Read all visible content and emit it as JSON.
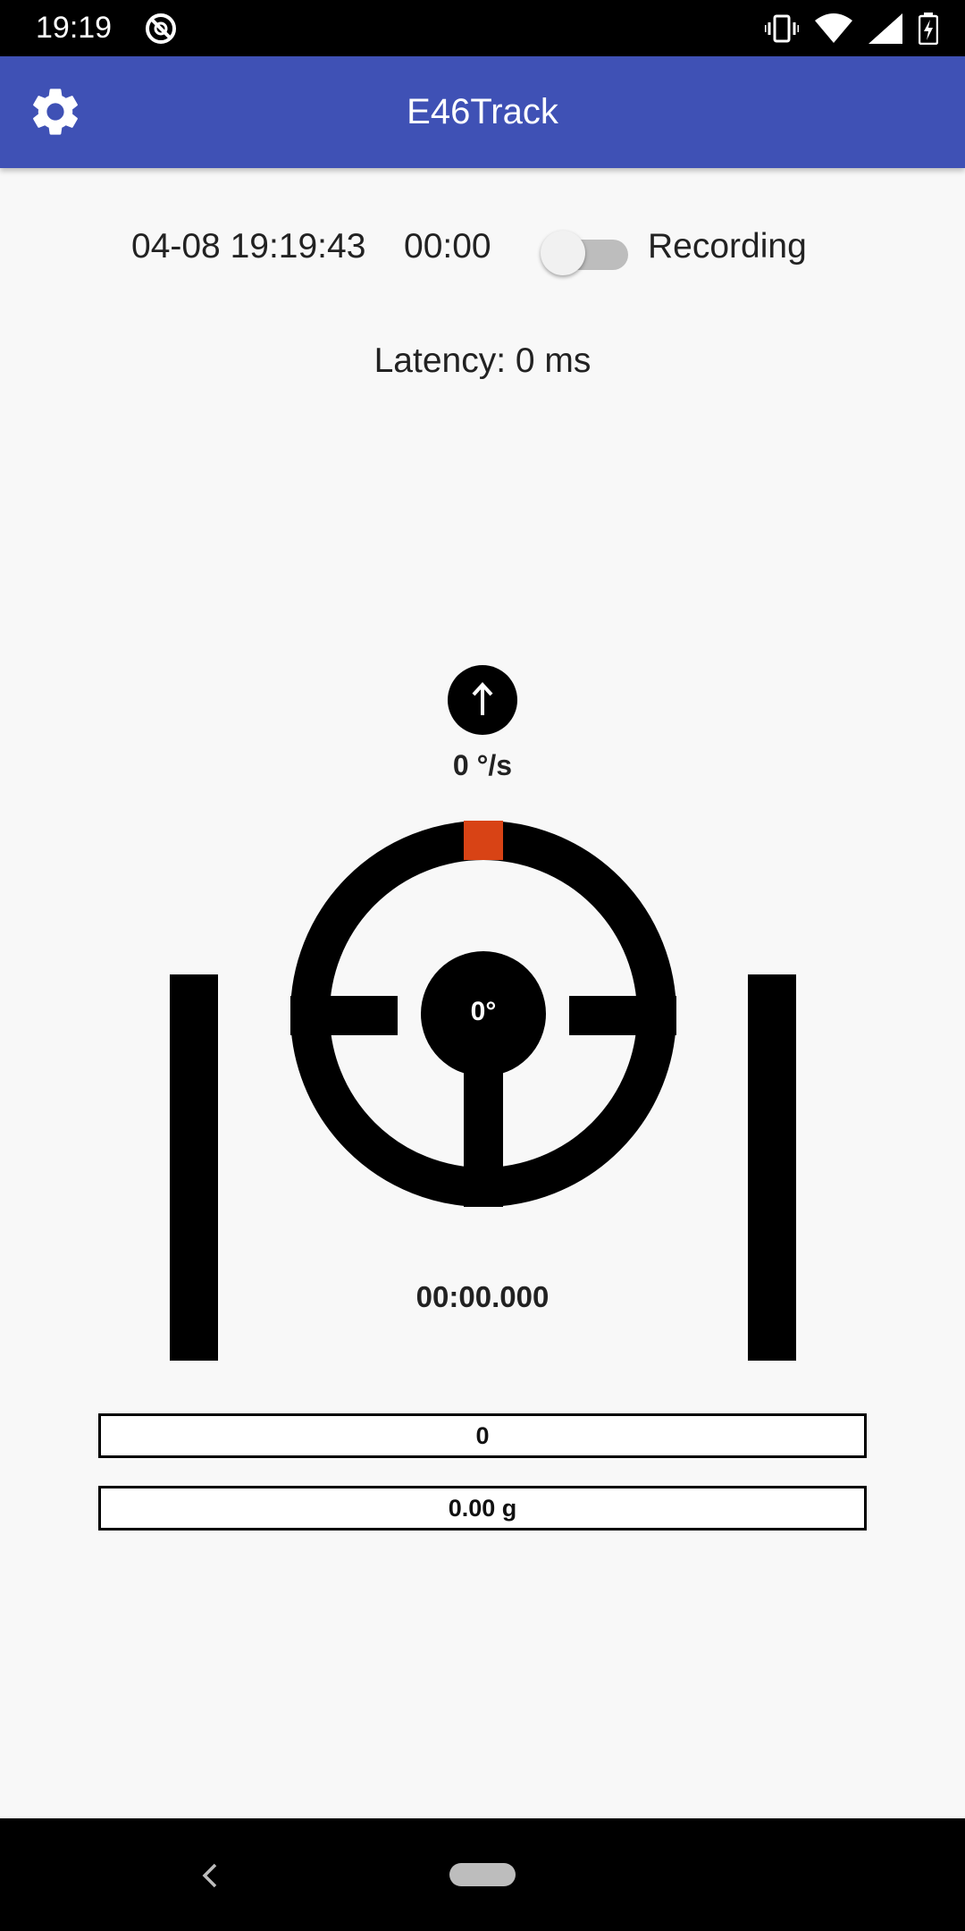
{
  "status_bar": {
    "time": "19:19",
    "icons": [
      "do-not-disturb-icon",
      "vibrate-icon",
      "wifi-icon",
      "signal-icon",
      "battery-charging-icon"
    ]
  },
  "app_bar": {
    "title": "E46Track",
    "settings_icon": "gear-icon",
    "color": "#3f51b5"
  },
  "session": {
    "datetime": "04-08 19:19:43",
    "elapsed": "00:00",
    "recording_label": "Recording",
    "recording_on": false
  },
  "latency": "Latency: 0 ms",
  "gauge": {
    "direction_icon": "arrow-up-icon",
    "arrow": "↑",
    "rate": "0 °/s",
    "steering_angle": "0°",
    "marker_color": "#d84315",
    "lap_time": "00:00.000",
    "brake_level": 1.0,
    "throttle_level": 1.0
  },
  "bars": {
    "speed": "0",
    "g_force": "0.00 g"
  },
  "nav_bar": {
    "back_icon": "chevron-left-icon",
    "home_icon": "home-pill-icon"
  }
}
